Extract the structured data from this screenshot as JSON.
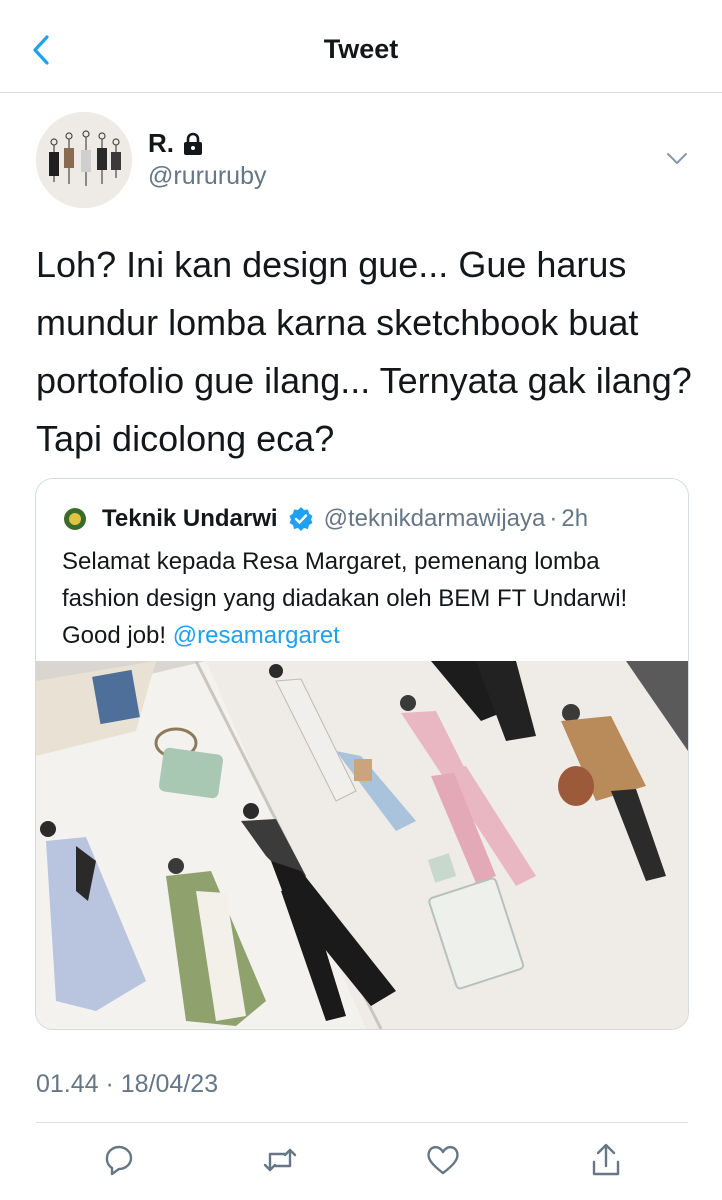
{
  "header": {
    "title": "Tweet",
    "back_icon": "chevron-left-icon"
  },
  "tweet": {
    "display_name": "R.",
    "protected_icon": "lock-icon",
    "handle": "@rururuby",
    "text": "Loh? Ini kan design gue... Gue harus mundur lomba karna sketchbook buat portofolio gue ilang... Ternyata gak ilang? Tapi dicolong eca?",
    "timestamp": "01.44 · 18/04/23"
  },
  "quoted": {
    "name": "Teknik Undarwi",
    "verified": true,
    "handle": "@teknikdarmawijaya",
    "separator": "·",
    "time": "2h",
    "text": "Selamat kepada Resa Margaret, pemenang lomba fashion design yang diadakan oleh BEM FT Undarwi! Good job! ",
    "mention": "@resamargaret",
    "image_description_icon": "sketchbook-fashion-illustration"
  },
  "actions": [
    {
      "name": "reply",
      "icon": "comment-icon"
    },
    {
      "name": "retweet",
      "icon": "retweet-icon"
    },
    {
      "name": "like",
      "icon": "heart-icon"
    },
    {
      "name": "share",
      "icon": "share-icon"
    }
  ],
  "colors": {
    "accent": "#1da1f2",
    "text_primary": "#14171a",
    "text_secondary": "#657786",
    "border": "#d9dee2"
  }
}
